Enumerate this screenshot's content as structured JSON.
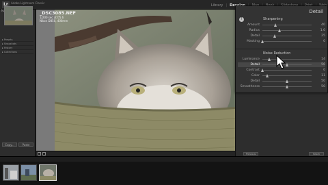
{
  "topbar": {
    "logo": "Lr",
    "app_name": "Adobe Lightroom Classic",
    "modules": [
      "Library",
      "Develop",
      "Map",
      "Book",
      "Slideshow",
      "Print",
      "Web"
    ],
    "active_module": "Develop"
  },
  "left_panel": {
    "navigator_label": "Navigator",
    "rows": [
      "Presets",
      "Snapshots",
      "History",
      "Collections"
    ],
    "copy_label": "Copy...",
    "paste_label": "Paste"
  },
  "photo_info": {
    "filename": "_DSC3085.NEF",
    "line1": "1/200 sec at f/5.6",
    "line2": "Nikon D850, 400mm"
  },
  "detail_panel": {
    "title": "Detail",
    "sharpening": {
      "title": "Sharpening",
      "sliders": [
        {
          "label": "Amount",
          "value": "40",
          "pos": 0.27
        },
        {
          "label": "Radius",
          "value": "1.0",
          "pos": 0.35
        },
        {
          "label": "Detail",
          "value": "25",
          "pos": 0.25
        },
        {
          "label": "Masking",
          "value": "0",
          "pos": 0.0
        }
      ]
    },
    "noise": {
      "title": "Noise Reduction",
      "sliders": [
        {
          "label": "Luminance",
          "value": "14",
          "pos": 0.14
        },
        {
          "label": "Detail",
          "value": "50",
          "pos": 0.5,
          "active": true
        },
        {
          "label": "Contrast",
          "value": "0",
          "pos": 0.0
        },
        {
          "label": "Color",
          "value": "11",
          "pos": 0.11
        },
        {
          "label": "Detail",
          "value": "50",
          "pos": 0.5
        },
        {
          "label": "Smoothness",
          "value": "50",
          "pos": 0.5
        }
      ]
    }
  },
  "bottom": {
    "previous_label": "Previous",
    "reset_label": "Reset"
  }
}
